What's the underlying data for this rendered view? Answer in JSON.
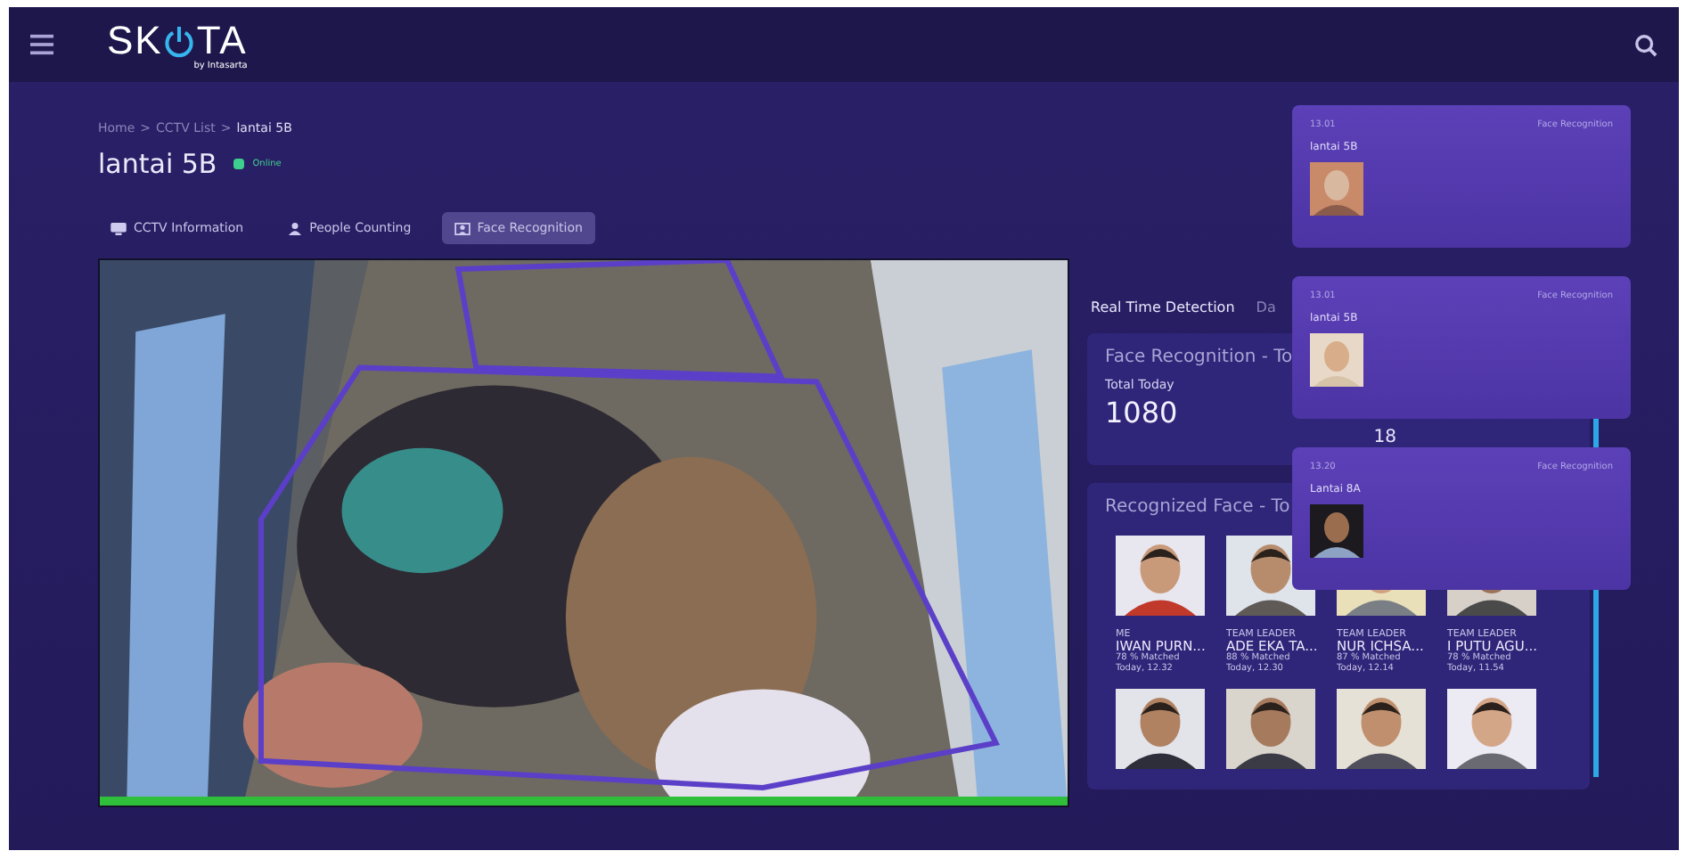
{
  "header": {
    "logo_left": "SK",
    "logo_right": "TA",
    "byline": "by Intasarta"
  },
  "breadcrumb": {
    "separator": ">",
    "items": [
      {
        "label": "Home",
        "current": false
      },
      {
        "label": "CCTV List",
        "current": false
      },
      {
        "label": "lantai 5B",
        "current": true
      }
    ]
  },
  "page": {
    "title": "lantai 5B",
    "online": true,
    "status": "Online"
  },
  "tabs": [
    {
      "label": "CCTV Information",
      "kind": "cctv",
      "selected": false
    },
    {
      "label": "People Counting",
      "kind": "people",
      "selected": false
    },
    {
      "label": "Face Recognition",
      "kind": "face",
      "selected": true
    }
  ],
  "camera": {
    "kind": "picture"
  },
  "detection_tabs": [
    {
      "label": "Real Time Detection",
      "selected": true
    },
    {
      "label": "Da",
      "selected": false
    }
  ],
  "summary_card": {
    "title": "Face Recognition - To",
    "total_label": "Total Today",
    "total": "1080",
    "second_value": "18"
  },
  "recognized": {
    "title": "Recognized Face - To",
    "faces": [
      {
        "kind": "picture",
        "role": "ME",
        "name": "IWAN PURN...",
        "match": "78 % Matched",
        "time": "Today, 12.32"
      },
      {
        "kind": "picture",
        "role": "TEAM LEADER",
        "name": "ADE EKA TA...",
        "match": "88 % Matched",
        "time": "Today, 12.30"
      },
      {
        "kind": "picture",
        "role": "TEAM LEADER",
        "name": "NUR ICHSA...",
        "match": "87 % Matched",
        "time": "Today, 12.14"
      },
      {
        "kind": "picture",
        "role": "TEAM LEADER",
        "name": "I PUTU AGU...",
        "match": "78 % Matched",
        "time": "Today, 11.54"
      },
      {
        "kind": "picture"
      },
      {
        "kind": "picture"
      },
      {
        "kind": "picture"
      },
      {
        "kind": "picture"
      }
    ]
  },
  "notifications": [
    {
      "time": "13.01",
      "type": "Face Recognition",
      "location": "lantai 5B"
    },
    {
      "time": "13.01",
      "type": "Face Recognition",
      "location": "lantai 5B"
    },
    {
      "time": "13.20",
      "type": "Face Recognition",
      "location": "Lantai 8A"
    }
  ]
}
